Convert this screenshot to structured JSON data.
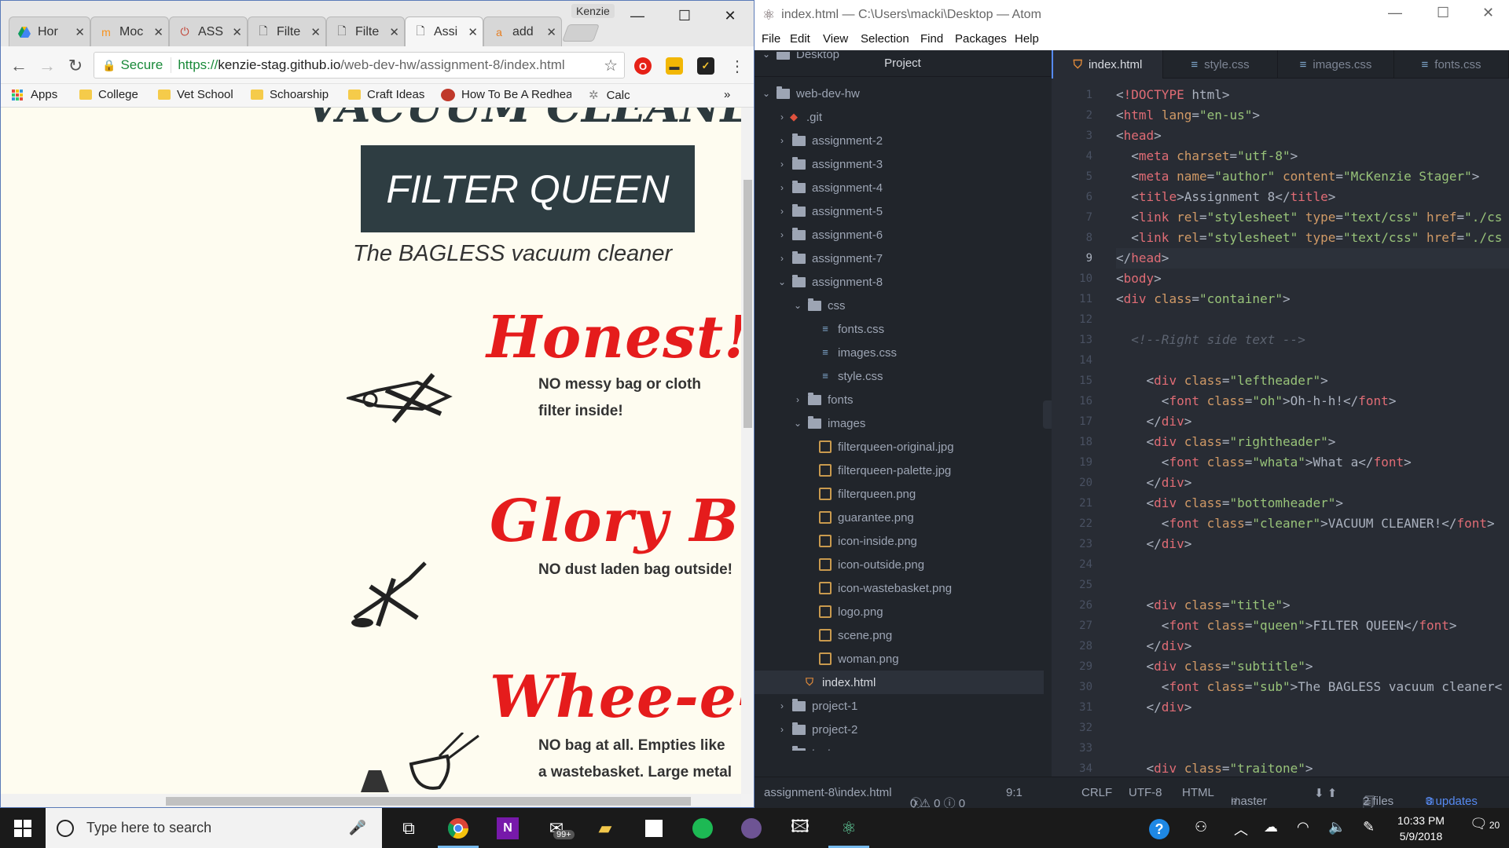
{
  "browser": {
    "profile": "Kenzie",
    "tabs": [
      {
        "label": "Hor",
        "icon": "google-drive-icon",
        "active": false
      },
      {
        "label": "Moc",
        "icon": "moodle-icon",
        "active": false
      },
      {
        "label": "ASS",
        "icon": "power-icon",
        "active": false
      },
      {
        "label": "Filte",
        "icon": "page-icon",
        "active": false
      },
      {
        "label": "Filte",
        "icon": "page-icon",
        "active": false
      },
      {
        "label": "Assi",
        "icon": "page-icon",
        "active": true
      },
      {
        "label": "add",
        "icon": "amazon-icon",
        "active": false
      }
    ],
    "secure_label": "Secure",
    "url_protocol": "https://",
    "url_host": "kenzie-stag.github.io",
    "url_path": "/web-dev-hw/assignment-8/index.html",
    "bookmarks": [
      "Apps",
      "College",
      "Vet School",
      "Schoarship",
      "Craft Ideas",
      "How To Be A Redhea",
      "Calc"
    ],
    "bookmarks_more": "»"
  },
  "webpage": {
    "header_partial": "VACUUM CLEANER!",
    "queen_title": "FILTER QUEEN",
    "subtitle": "The BAGLESS vacuum cleaner",
    "features": [
      {
        "heading": "Honest!",
        "text_line1": "NO messy bag or cloth",
        "text_line2": "filter inside!"
      },
      {
        "heading": "Glory Be!",
        "text_line1": "NO dust laden bag outside!",
        "text_line2": ""
      },
      {
        "heading": "Whee-e-e",
        "text_line1": "NO bag at all. Empties like",
        "text_line2": "a wastebasket. Large metal"
      }
    ]
  },
  "atom": {
    "window_title": "index.html — C:\\Users\\macki\\Desktop — Atom",
    "menu": [
      "File",
      "Edit",
      "View",
      "Selection",
      "Find",
      "Packages",
      "Help"
    ],
    "panel_title": "Project",
    "tree": [
      {
        "label": "Desktop",
        "depth": 0,
        "type": "dir",
        "open": true
      },
      {
        "label": "web-dev-hw",
        "depth": 0,
        "type": "dir",
        "open": true
      },
      {
        "label": ".git",
        "depth": 1,
        "type": "git",
        "open": false
      },
      {
        "label": "assignment-2",
        "depth": 1,
        "type": "dir",
        "open": false
      },
      {
        "label": "assignment-3",
        "depth": 1,
        "type": "dir",
        "open": false
      },
      {
        "label": "assignment-4",
        "depth": 1,
        "type": "dir",
        "open": false
      },
      {
        "label": "assignment-5",
        "depth": 1,
        "type": "dir",
        "open": false
      },
      {
        "label": "assignment-6",
        "depth": 1,
        "type": "dir",
        "open": false
      },
      {
        "label": "assignment-7",
        "depth": 1,
        "type": "dir",
        "open": false
      },
      {
        "label": "assignment-8",
        "depth": 1,
        "type": "dir",
        "open": true
      },
      {
        "label": "css",
        "depth": 2,
        "type": "dir",
        "open": true
      },
      {
        "label": "fonts.css",
        "depth": 3,
        "type": "css"
      },
      {
        "label": "images.css",
        "depth": 3,
        "type": "css"
      },
      {
        "label": "style.css",
        "depth": 3,
        "type": "css"
      },
      {
        "label": "fonts",
        "depth": 2,
        "type": "dir",
        "open": false
      },
      {
        "label": "images",
        "depth": 2,
        "type": "dir",
        "open": true
      },
      {
        "label": "filterqueen-original.jpg",
        "depth": 3,
        "type": "img"
      },
      {
        "label": "filterqueen-palette.jpg",
        "depth": 3,
        "type": "img"
      },
      {
        "label": "filterqueen.png",
        "depth": 3,
        "type": "img"
      },
      {
        "label": "guarantee.png",
        "depth": 3,
        "type": "img"
      },
      {
        "label": "icon-inside.png",
        "depth": 3,
        "type": "img"
      },
      {
        "label": "icon-outside.png",
        "depth": 3,
        "type": "img"
      },
      {
        "label": "icon-wastebasket.png",
        "depth": 3,
        "type": "img"
      },
      {
        "label": "logo.png",
        "depth": 3,
        "type": "img"
      },
      {
        "label": "scene.png",
        "depth": 3,
        "type": "img"
      },
      {
        "label": "woman.png",
        "depth": 3,
        "type": "img"
      },
      {
        "label": "index.html",
        "depth": 2,
        "type": "html",
        "selected": true
      },
      {
        "label": "project-1",
        "depth": 1,
        "type": "dir",
        "open": false
      },
      {
        "label": "project-2",
        "depth": 1,
        "type": "dir",
        "open": false
      },
      {
        "label": "test",
        "depth": 1,
        "type": "dir",
        "open": false
      }
    ],
    "editor_tabs": [
      "index.html",
      "style.css",
      "images.css",
      "fonts.css"
    ],
    "current_line": 9,
    "code": [
      "<!DOCTYPE html>",
      "<html lang=\"en-us\">",
      "<head>",
      "  <meta charset=\"utf-8\">",
      "  <meta name=\"author\" content=\"McKenzie Stager\">",
      "  <title>Assignment 8</title>",
      "  <link rel=\"stylesheet\" type=\"text/css\" href=\"./cs",
      "  <link rel=\"stylesheet\" type=\"text/css\" href=\"./cs",
      "</head>",
      "<body>",
      "<div class=\"container\">",
      "",
      "  <!--Right side text -->",
      "",
      "    <div class=\"leftheader\">",
      "      <font class=\"oh\">Oh-h-h!</font>",
      "    </div>",
      "    <div class=\"rightheader\">",
      "      <font class=\"whata\">What a</font>",
      "    </div>",
      "    <div class=\"bottomheader\">",
      "      <font class=\"cleaner\">VACUUM CLEANER!</font>",
      "    </div>",
      "",
      "",
      "    <div class=\"title\">",
      "      <font class=\"queen\">FILTER QUEEN</font>",
      "    </div>",
      "    <div class=\"subtitle\">",
      "      <font class=\"sub\">The BAGLESS vacuum cleaner<",
      "    </div>",
      "",
      "",
      "    <div class=\"traitone\">"
    ],
    "status": {
      "path": "assignment-8\\index.html",
      "diagnostics": "0 ⚠ 0 ⓘ 0",
      "position": "9:1",
      "line_ending": "CRLF",
      "encoding": "UTF-8",
      "grammar": "HTML",
      "branch": "master",
      "files": "2 files",
      "updates": "3 updates"
    }
  },
  "taskbar": {
    "search_placeholder": "Type here to search",
    "mail_badge": "99+",
    "time": "10:33 PM",
    "date": "5/9/2018",
    "notifications": "20"
  }
}
